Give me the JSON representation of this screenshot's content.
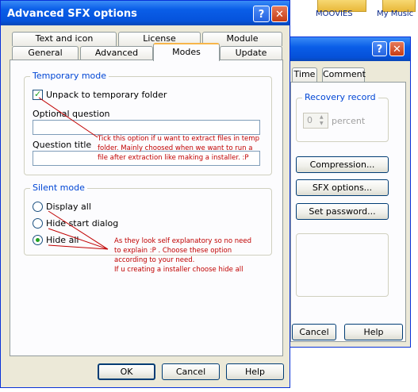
{
  "desktop": {
    "icons": [
      {
        "label": "MOOVIES"
      },
      {
        "label": "My Music"
      }
    ]
  },
  "background_window": {
    "tabs": [
      "Time",
      "Comment"
    ],
    "recovery_group": "Recovery record",
    "recovery_value": "0",
    "recovery_unit": "percent",
    "buttons": [
      "Compression...",
      "SFX options...",
      "Set password..."
    ],
    "footer_buttons": [
      "Cancel",
      "Help"
    ]
  },
  "dialog": {
    "title": "Advanced SFX options",
    "tabs_row1": [
      "Text and icon",
      "License",
      "Module"
    ],
    "tabs_row2": [
      "General",
      "Advanced",
      "Modes",
      "Update"
    ],
    "active_tab": "Modes",
    "temp_group": {
      "legend": "Temporary mode",
      "unpack_label": "Unpack to temporary folder",
      "unpack_checked": true,
      "optional_question_label": "Optional question",
      "optional_question_value": "",
      "question_title_label": "Question title",
      "question_title_value": ""
    },
    "silent_group": {
      "legend": "Silent mode",
      "options": [
        "Display all",
        "Hide start dialog",
        "Hide all"
      ],
      "selected": "Hide all"
    },
    "annotations": {
      "note1": "Tick this option if u want to extract files in temp folder. Mainly choosed when we want to run a file after extraction like making a installer. :P",
      "note2_line1": "As they look self explanatory so no need",
      "note2_line2": "to explain :P . Choose these option",
      "note2_line3": "according to your need.",
      "note2_line4": "If u creating a installer choose hide all"
    },
    "buttons": {
      "ok": "OK",
      "cancel": "Cancel",
      "help": "Help"
    },
    "title_help_glyph": "?",
    "title_close_glyph": "✕"
  },
  "colors": {
    "title_blue": "#0a5ee8",
    "annotation_red": "#c00000",
    "groupbox_label_blue": "#0046d5"
  }
}
